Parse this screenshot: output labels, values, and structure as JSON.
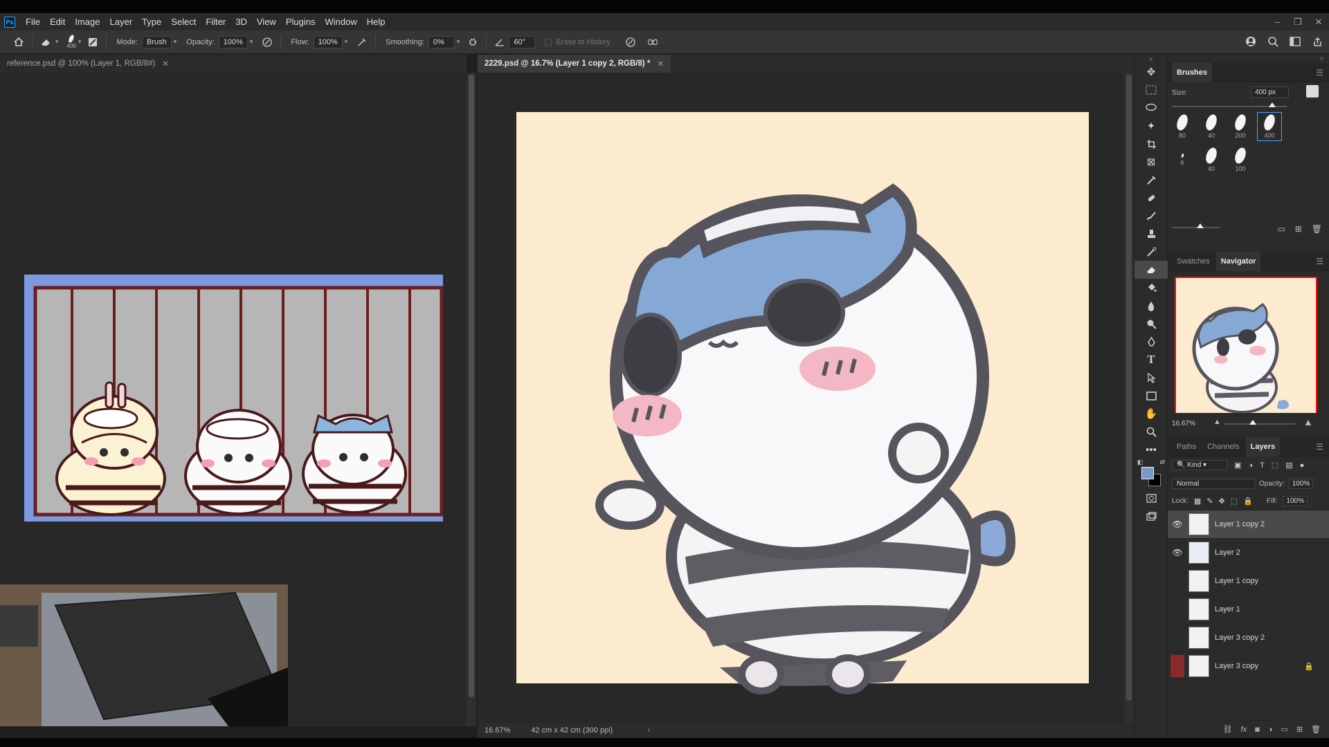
{
  "app": {
    "logo": "Ps"
  },
  "menu": [
    "File",
    "Edit",
    "Image",
    "Layer",
    "Type",
    "Select",
    "Filter",
    "3D",
    "View",
    "Plugins",
    "Window",
    "Help"
  ],
  "window_controls": {
    "minimize": "–",
    "restore": "❐",
    "close": "✕"
  },
  "options": {
    "brush_size": "400",
    "mode_label": "Mode:",
    "mode_value": "Brush",
    "opacity_label": "Opacity:",
    "opacity_value": "100%",
    "flow_label": "Flow:",
    "flow_value": "100%",
    "smoothing_label": "Smoothing:",
    "smoothing_value": "0%",
    "angle_value": "60°",
    "erase_history_label": "Erase to History"
  },
  "tabs": {
    "left": {
      "label": "reference.psd @ 100% (Layer 1, RGB/8#)"
    },
    "right": {
      "label": "2229.psd @ 16.7% (Layer 1 copy 2, RGB/8) *"
    }
  },
  "status": {
    "zoom": "16.67%",
    "doc_info": "42 cm x 42 cm (300 ppi)"
  },
  "brushes_panel": {
    "title": "Brushes",
    "size_label": "Size:",
    "size_value": "400 px",
    "presets": [
      "80",
      "40",
      "200",
      "400",
      "6",
      "40",
      "100"
    ]
  },
  "navigator_panel": {
    "tabs": [
      "Swatches",
      "Navigator"
    ],
    "zoom": "16.67%"
  },
  "layers_panel": {
    "tabs": [
      "Paths",
      "Channels",
      "Layers"
    ],
    "filter": "Kind",
    "blend_mode": "Normal",
    "opacity_label": "Opacity:",
    "opacity_value": "100%",
    "lock_label": "Lock:",
    "fill_label": "Fill:",
    "fill_value": "100%",
    "layers": [
      {
        "name": "Layer 1 copy 2",
        "visible": true,
        "selected": true
      },
      {
        "name": "Layer 2",
        "visible": true
      },
      {
        "name": "Layer 1 copy",
        "visible": false
      },
      {
        "name": "Layer 1",
        "visible": false
      },
      {
        "name": "Layer 3 copy 2",
        "visible": false
      },
      {
        "name": "Layer 3 copy",
        "visible": false,
        "locked": true
      }
    ]
  },
  "colors": {
    "accent": "#31a8ff",
    "canvas_bg": "#fdebd0",
    "foreground": "#7d97c9",
    "background": "#000000"
  }
}
